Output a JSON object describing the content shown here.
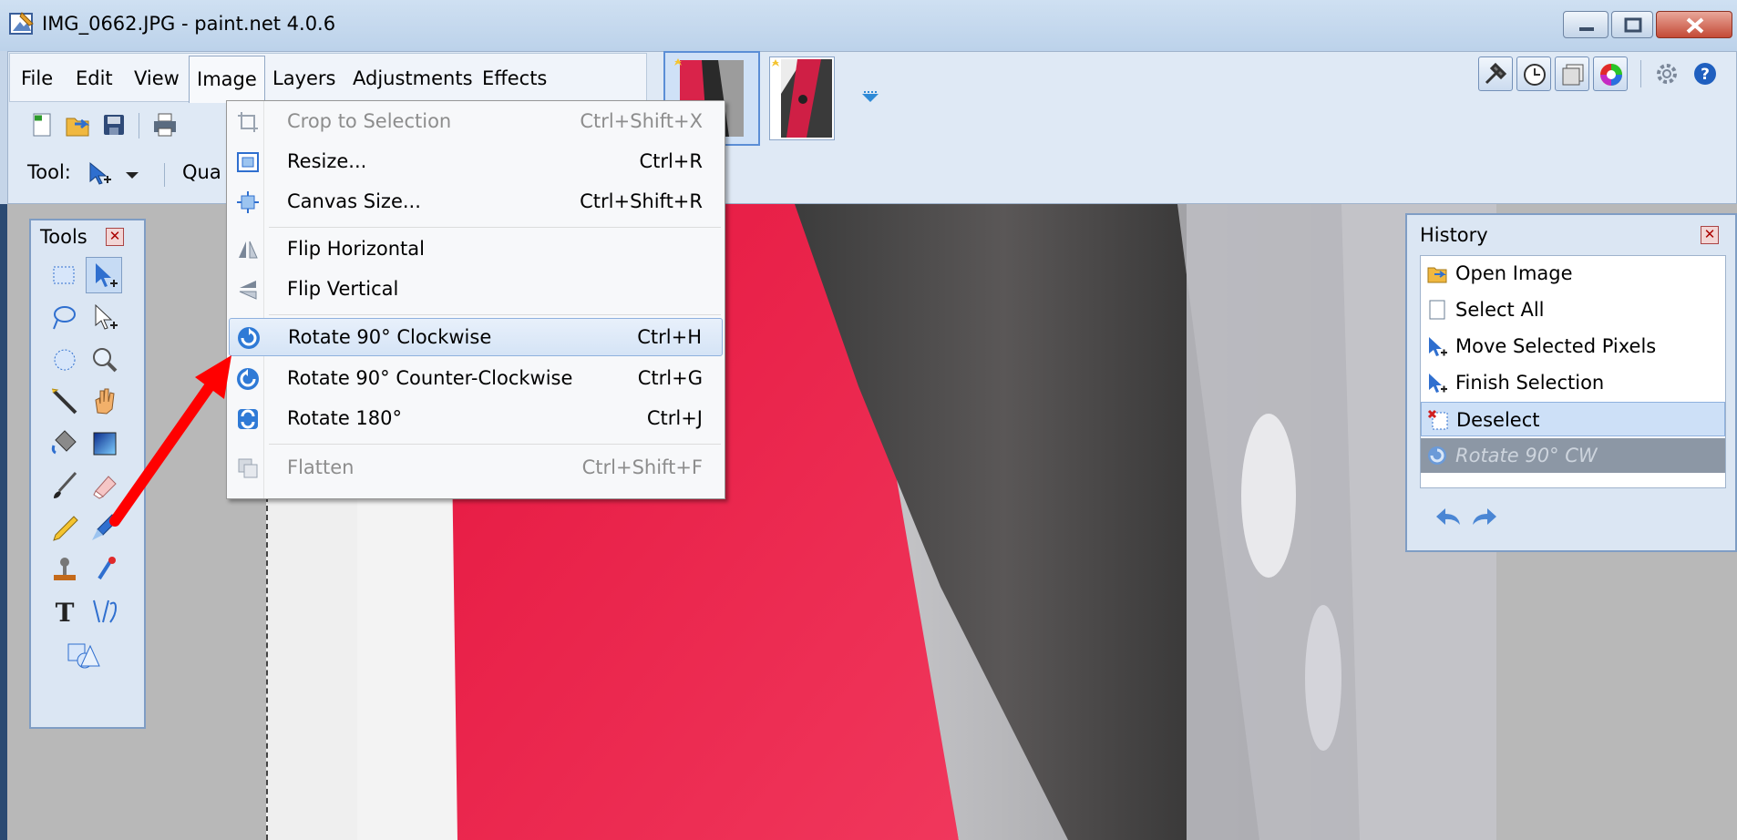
{
  "window": {
    "title": "IMG_0662.JPG - paint.net 4.0.6"
  },
  "menubar": {
    "items": [
      "File",
      "Edit",
      "View",
      "Image",
      "Layers",
      "Adjustments",
      "Effects"
    ],
    "active": "Image"
  },
  "toolbar": {
    "tool_label": "Tool:",
    "quality_label_partial": "Qua"
  },
  "image_menu": {
    "items": [
      {
        "label": "Crop to Selection",
        "shortcut": "Ctrl+Shift+X",
        "enabled": false,
        "icon": "crop-icon"
      },
      {
        "label": "Resize...",
        "shortcut": "Ctrl+R",
        "enabled": true,
        "icon": "resize-icon"
      },
      {
        "label": "Canvas Size...",
        "shortcut": "Ctrl+Shift+R",
        "enabled": true,
        "icon": "canvas-size-icon"
      },
      {
        "label": "Flip Horizontal",
        "shortcut": "",
        "enabled": true,
        "icon": "flip-horizontal-icon"
      },
      {
        "label": "Flip Vertical",
        "shortcut": "",
        "enabled": true,
        "icon": "flip-vertical-icon"
      },
      {
        "label": "Rotate 90° Clockwise",
        "shortcut": "Ctrl+H",
        "enabled": true,
        "highlighted": true,
        "icon": "rotate-cw-icon"
      },
      {
        "label": "Rotate 90° Counter-Clockwise",
        "shortcut": "Ctrl+G",
        "enabled": true,
        "icon": "rotate-ccw-icon"
      },
      {
        "label": "Rotate 180°",
        "shortcut": "Ctrl+J",
        "enabled": true,
        "icon": "rotate-180-icon"
      },
      {
        "label": "Flatten",
        "shortcut": "Ctrl+Shift+F",
        "enabled": false,
        "icon": "flatten-icon"
      }
    ]
  },
  "tools_panel": {
    "title": "Tools",
    "close": "✕"
  },
  "history_panel": {
    "title": "History",
    "close": "✕",
    "items": [
      {
        "label": "Open Image",
        "icon": "open-folder-icon"
      },
      {
        "label": "Select All",
        "icon": "page-icon"
      },
      {
        "label": "Move Selected Pixels",
        "icon": "move-selection-icon"
      },
      {
        "label": "Finish Selection",
        "icon": "move-selection-icon"
      },
      {
        "label": "Deselect",
        "icon": "deselect-icon",
        "selected": true
      },
      {
        "label": "Rotate 90° CW",
        "icon": "rotate-cw-icon",
        "undone": true
      }
    ]
  },
  "colors": {
    "accent": "#5b8ed6",
    "menu_highlight": "#d5e4f6",
    "annotation_arrow": "#ff0000",
    "photo_red": "#e02545"
  }
}
